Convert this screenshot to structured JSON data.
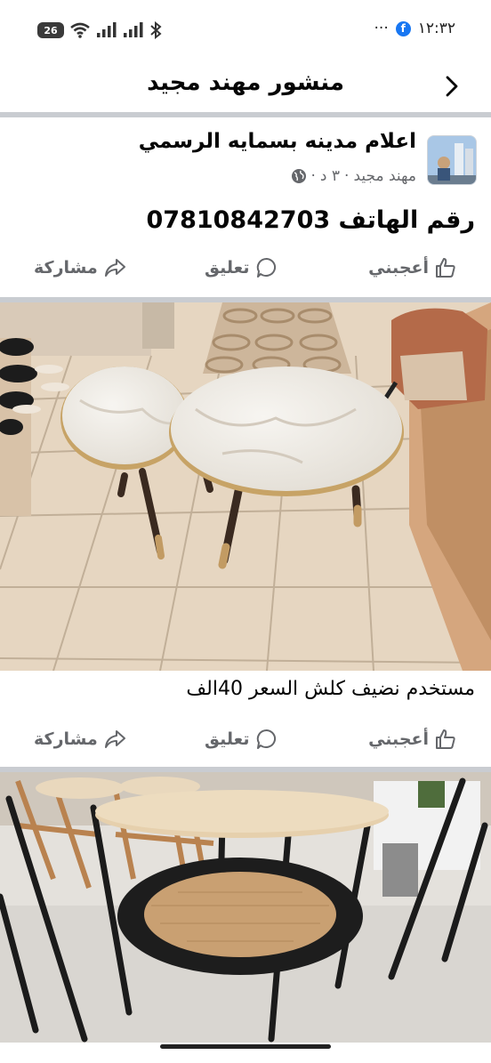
{
  "status_bar": {
    "battery": "26",
    "time": "١٢:٣٢",
    "dots": "···"
  },
  "header": {
    "title": "منشور مهند مجيد"
  },
  "post": {
    "page_name": "اعلام مدينه بسمايه الرسمي",
    "author": "مهند مجيد",
    "time_ago": "٣ د",
    "separator": "·",
    "text": "رقم الهاتف 07810842703"
  },
  "photo1": {
    "caption": "مستخدم نضيف كلش السعر 40الف"
  },
  "actions": {
    "like": "أعجبني",
    "comment": "تعليق",
    "share": "مشاركة"
  },
  "icons": {
    "back": "chevron-right-icon",
    "like": "thumbs-up-icon",
    "comment": "comment-bubble-icon",
    "share": "share-arrow-icon",
    "privacy": "globe-icon"
  },
  "colors": {
    "text": "#050505",
    "secondary": "#65676b",
    "divider": "#c9ccd1",
    "facebook_blue": "#1877f2"
  }
}
